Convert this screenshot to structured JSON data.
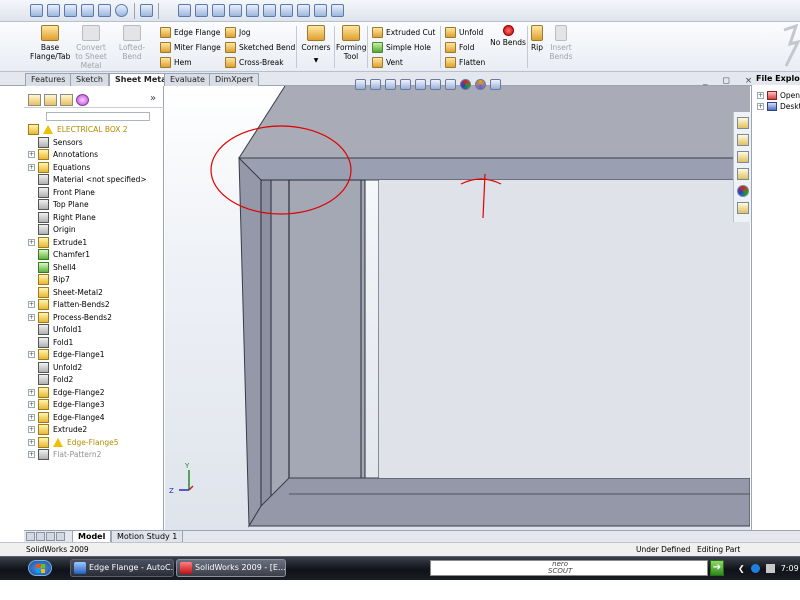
{
  "app": {
    "status_left": "SolidWorks 2009",
    "status_state": "Under Defined",
    "status_mode": "Editing Part"
  },
  "command_manager": {
    "big_buttons": [
      {
        "label": "Base\nFlange/Tab",
        "enabled": true,
        "icon": "base-flange-icon"
      },
      {
        "label": "Convert\nto Sheet\nMetal",
        "enabled": false,
        "icon": "convert-sheet-metal-icon"
      },
      {
        "label": "Lofted-Bend",
        "enabled": false,
        "icon": "lofted-bend-icon"
      }
    ],
    "col1": [
      "Edge Flange",
      "Miter Flange",
      "Hem"
    ],
    "col2": [
      "Jog",
      "Sketched Bend",
      "Cross-Break"
    ],
    "corners": "Corners",
    "forming_tool": "Forming\nTool",
    "col3": [
      "Extruded Cut",
      "Simple Hole",
      "Vent"
    ],
    "col4": [
      "Unfold",
      "Fold",
      "Flatten"
    ],
    "no_bends": "No Bends",
    "rip": "Rip",
    "insert_bends": "Insert\nBends"
  },
  "tabs": [
    "Features",
    "Sketch",
    "Sheet Metal",
    "Evaluate",
    "DimXpert"
  ],
  "active_tab": "Sheet Metal",
  "feature_tree": {
    "root": "ELECTRICAL BOX 2",
    "items": [
      {
        "label": "Sensors",
        "expand": false,
        "style": "normal"
      },
      {
        "label": "Annotations",
        "expand": true,
        "style": "normal"
      },
      {
        "label": "Equations",
        "expand": true,
        "style": "normal"
      },
      {
        "label": "Material <not specified>",
        "expand": false,
        "style": "normal"
      },
      {
        "label": "Front Plane",
        "expand": false,
        "style": "normal"
      },
      {
        "label": "Top Plane",
        "expand": false,
        "style": "normal"
      },
      {
        "label": "Right Plane",
        "expand": false,
        "style": "normal"
      },
      {
        "label": "Origin",
        "expand": false,
        "style": "normal"
      },
      {
        "label": "Extrude1",
        "expand": true,
        "style": "normal"
      },
      {
        "label": "Chamfer1",
        "expand": false,
        "style": "normal"
      },
      {
        "label": "Shell4",
        "expand": false,
        "style": "normal"
      },
      {
        "label": "Rip7",
        "expand": false,
        "style": "normal"
      },
      {
        "label": "Sheet-Metal2",
        "expand": false,
        "style": "normal"
      },
      {
        "label": "Flatten-Bends2",
        "expand": true,
        "style": "normal"
      },
      {
        "label": "Process-Bends2",
        "expand": true,
        "style": "normal"
      },
      {
        "label": "Unfold1",
        "expand": false,
        "style": "normal"
      },
      {
        "label": "Fold1",
        "expand": false,
        "style": "normal"
      },
      {
        "label": "Edge-Flange1",
        "expand": true,
        "style": "normal"
      },
      {
        "label": "Unfold2",
        "expand": false,
        "style": "normal"
      },
      {
        "label": "Fold2",
        "expand": false,
        "style": "normal"
      },
      {
        "label": "Edge-Flange2",
        "expand": true,
        "style": "normal"
      },
      {
        "label": "Edge-Flange3",
        "expand": true,
        "style": "normal"
      },
      {
        "label": "Edge-Flange4",
        "expand": true,
        "style": "normal"
      },
      {
        "label": "Extrude2",
        "expand": true,
        "style": "normal"
      },
      {
        "label": "Edge-Flange5",
        "expand": true,
        "style": "warning"
      },
      {
        "label": "Flat-Pattern2",
        "expand": true,
        "style": "suppressed"
      }
    ]
  },
  "file_explorer": {
    "title": "File Explorer",
    "items": [
      "Open",
      "Desktop"
    ]
  },
  "bottom_tabs": [
    "Model",
    "Motion Study 1"
  ],
  "active_bottom_tab": "Model",
  "taskbar": {
    "buttons": [
      "Edge Flange - AutoC...",
      "SolidWorks 2009 - [E..."
    ],
    "nero": "nero\nSCOUT",
    "go": "➔",
    "clock": "7:09"
  },
  "triad": {
    "y": "Y",
    "z": "Z"
  },
  "colors": {
    "accent": "#1a4c9a",
    "sketch": "#e00000",
    "model_face": "#a9acb6"
  }
}
